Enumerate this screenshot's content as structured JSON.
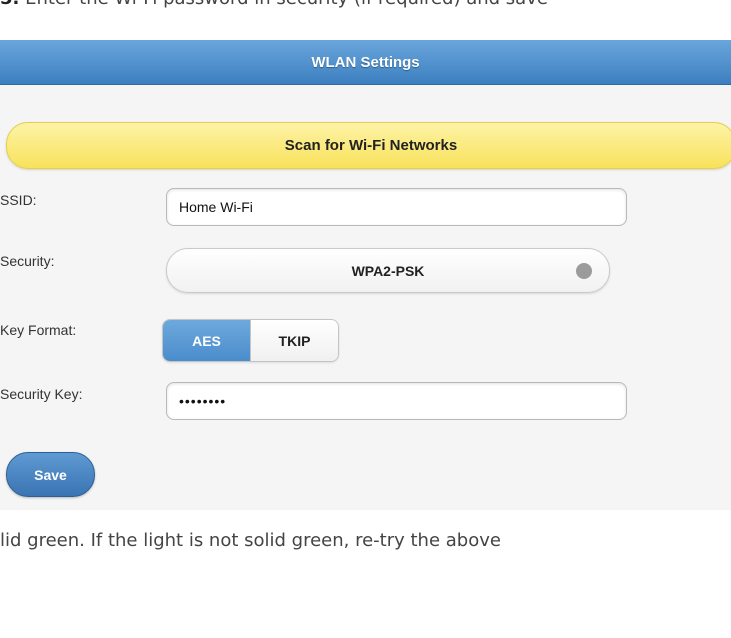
{
  "instructions": {
    "step_number": "5.",
    "step_text": "Enter the Wi-Fi password in security (if required) and save",
    "followup_text": "lid green. If the light is not solid green, re-try the above"
  },
  "wlan": {
    "title": "WLAN Settings",
    "scan_button_label": "Scan for Wi-Fi Networks",
    "ssid_label": "SSID:",
    "ssid_value": "Home Wi-Fi",
    "security_label": "Security:",
    "security_value": "WPA2-PSK",
    "key_format_label": "Key Format:",
    "key_formats": [
      {
        "label": "AES",
        "selected": true
      },
      {
        "label": "TKIP",
        "selected": false
      }
    ],
    "security_key_label": "Security Key:",
    "security_key_value": "••••••••",
    "save_label": "Save"
  },
  "colors": {
    "header_blue": "#3c7fc0",
    "scan_yellow": "#f8e25a",
    "active_blue": "#4a8ccc"
  }
}
